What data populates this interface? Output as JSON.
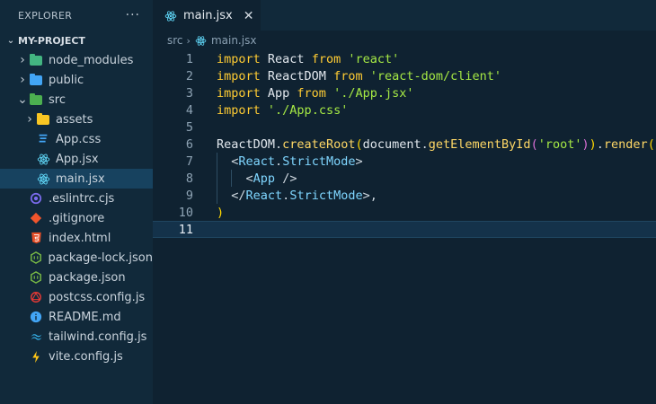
{
  "explorer": {
    "title": "EXPLORER",
    "more": "···",
    "project": "MY-PROJECT",
    "items": [
      {
        "label": "node_modules",
        "indent": 1,
        "type": "folder",
        "color": "#43b581",
        "chevron": "›"
      },
      {
        "label": "public",
        "indent": 1,
        "type": "folder",
        "color": "#42a5f5",
        "chevron": "›"
      },
      {
        "label": "src",
        "indent": 1,
        "type": "folder",
        "color": "#4caf50",
        "chevron": "⌄"
      },
      {
        "label": "assets",
        "indent": 2,
        "type": "folder",
        "color": "#f9c623",
        "chevron": "›"
      },
      {
        "label": "App.css",
        "indent": 2,
        "type": "css",
        "color": "#42a5f5"
      },
      {
        "label": "App.jsx",
        "indent": 2,
        "type": "react",
        "color": "#61dafb"
      },
      {
        "label": "main.jsx",
        "indent": 2,
        "type": "react",
        "color": "#61dafb",
        "active": true
      },
      {
        "label": ".eslintrc.cjs",
        "indent": 1,
        "type": "eslint",
        "color": "#7c6cf0"
      },
      {
        "label": ".gitignore",
        "indent": 1,
        "type": "git",
        "color": "#f0552c"
      },
      {
        "label": "index.html",
        "indent": 1,
        "type": "html",
        "color": "#e44d26"
      },
      {
        "label": "package-lock.json",
        "indent": 1,
        "type": "node",
        "color": "#7bbd45"
      },
      {
        "label": "package.json",
        "indent": 1,
        "type": "node",
        "color": "#7bbd45"
      },
      {
        "label": "postcss.config.js",
        "indent": 1,
        "type": "postcss",
        "color": "#e53935"
      },
      {
        "label": "README.md",
        "indent": 1,
        "type": "info",
        "color": "#42a5f5"
      },
      {
        "label": "tailwind.config.js",
        "indent": 1,
        "type": "tailwind",
        "color": "#38bdf8"
      },
      {
        "label": "vite.config.js",
        "indent": 1,
        "type": "vite",
        "color": "#ffc517"
      }
    ]
  },
  "editor": {
    "tab": {
      "label": "main.jsx",
      "close": "✕"
    },
    "breadcrumb": {
      "folder": "src",
      "file": "main.jsx"
    },
    "lines": [
      [
        [
          "kw",
          "import"
        ],
        [
          "pl",
          " React "
        ],
        [
          "kw",
          "from"
        ],
        [
          "pl",
          " "
        ],
        [
          "str",
          "'react'"
        ]
      ],
      [
        [
          "kw",
          "import"
        ],
        [
          "pl",
          " ReactDOM "
        ],
        [
          "kw",
          "from"
        ],
        [
          "pl",
          " "
        ],
        [
          "str",
          "'react-dom/client'"
        ]
      ],
      [
        [
          "kw",
          "import"
        ],
        [
          "pl",
          " App "
        ],
        [
          "kw",
          "from"
        ],
        [
          "pl",
          " "
        ],
        [
          "str",
          "'./App.jsx'"
        ]
      ],
      [
        [
          "kw",
          "import"
        ],
        [
          "pl",
          " "
        ],
        [
          "str",
          "'./App.css'"
        ]
      ],
      [],
      [
        [
          "pl",
          "ReactDOM"
        ],
        [
          "punc",
          "."
        ],
        [
          "fn",
          "createRoot"
        ],
        [
          "br1",
          "("
        ],
        [
          "pl",
          "document"
        ],
        [
          "punc",
          "."
        ],
        [
          "fn",
          "getElementById"
        ],
        [
          "br2",
          "("
        ],
        [
          "str",
          "'root'"
        ],
        [
          "br2",
          ")"
        ],
        [
          "br1",
          ")"
        ],
        [
          "punc",
          "."
        ],
        [
          "fn",
          "render"
        ],
        [
          "br1",
          "("
        ]
      ],
      [
        [
          "pl",
          "  "
        ],
        [
          "punc",
          "<"
        ],
        [
          "tag",
          "React"
        ],
        [
          "punc",
          "."
        ],
        [
          "tag",
          "StrictMode"
        ],
        [
          "punc",
          ">"
        ]
      ],
      [
        [
          "pl",
          "    "
        ],
        [
          "punc",
          "<"
        ],
        [
          "tag",
          "App"
        ],
        [
          "pl",
          " "
        ],
        [
          "punc",
          "/>"
        ]
      ],
      [
        [
          "pl",
          "  "
        ],
        [
          "punc",
          "</"
        ],
        [
          "tag",
          "React"
        ],
        [
          "punc",
          "."
        ],
        [
          "tag",
          "StrictMode"
        ],
        [
          "punc",
          ">,"
        ]
      ],
      [
        [
          "br1",
          ")"
        ]
      ],
      []
    ],
    "current_line": 11
  }
}
